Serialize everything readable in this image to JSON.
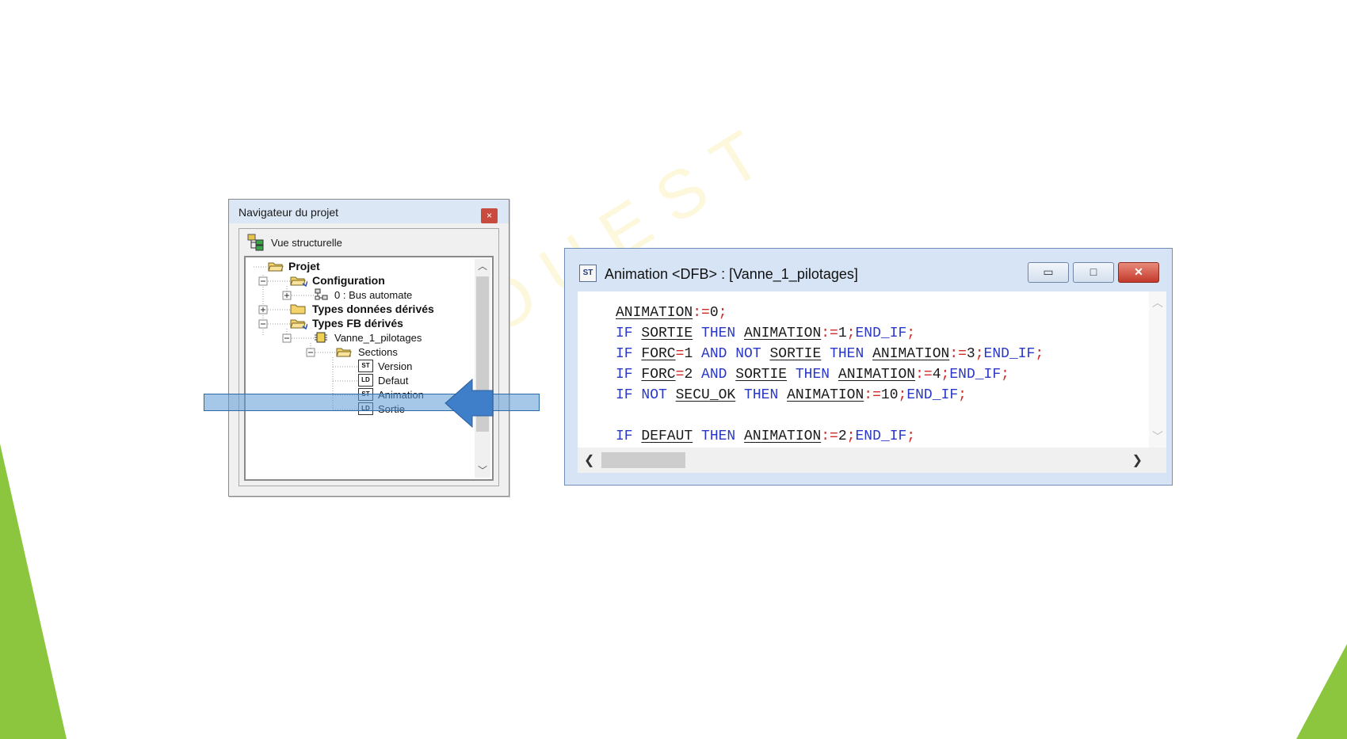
{
  "watermark": {
    "text": "AEI OUEST"
  },
  "navigator": {
    "title": "Navigateur du projet",
    "close_label": "×",
    "view_label": "Vue structurelle",
    "tree": [
      {
        "label": "Projet",
        "icon": "folder-open-icon",
        "bold": true
      },
      {
        "label": "Configuration",
        "icon": "folder-open-icon",
        "bold": true
      },
      {
        "label": "0 : Bus automate",
        "icon": "network-icon",
        "bold": false
      },
      {
        "label": "Types données dérivés",
        "icon": "folder-icon",
        "bold": true
      },
      {
        "label": "Types FB dérivés",
        "icon": "folder-open-icon",
        "bold": true
      },
      {
        "label": "Vanne_1_pilotages",
        "icon": "function-block-icon",
        "bold": false
      },
      {
        "label": "Sections",
        "icon": "folder-open-icon",
        "bold": false
      },
      {
        "label": "Version",
        "icon": "st-section-icon",
        "badge": "ST",
        "bold": false
      },
      {
        "label": "Defaut",
        "icon": "ld-section-icon",
        "badge": "LD",
        "bold": false
      },
      {
        "label": "Animation",
        "icon": "st-section-icon",
        "badge": "ST",
        "bold": false,
        "highlighted": true
      },
      {
        "label": "Sortie",
        "icon": "ld-section-icon",
        "badge": "LD",
        "bold": false
      }
    ]
  },
  "code_window": {
    "title": "Animation <DFB> : [Vanne_1_pilotages]",
    "app_icon_text": "ST",
    "buttons": {
      "minimize": "▭",
      "maximize": "□",
      "close": "✕"
    },
    "lines": [
      [
        {
          "t": "ANIMATION",
          "k": "var"
        },
        {
          "t": ":=",
          "k": "op"
        },
        {
          "t": "0",
          "k": "num"
        },
        {
          "t": ";",
          "k": "op"
        }
      ],
      [
        {
          "t": "IF ",
          "k": "kw"
        },
        {
          "t": "SORTIE",
          "k": "var"
        },
        {
          "t": " THEN ",
          "k": "kw"
        },
        {
          "t": "ANIMATION",
          "k": "var"
        },
        {
          "t": ":=",
          "k": "op"
        },
        {
          "t": "1",
          "k": "num"
        },
        {
          "t": ";",
          "k": "op"
        },
        {
          "t": "END_IF",
          "k": "kw"
        },
        {
          "t": ";",
          "k": "op"
        }
      ],
      [
        {
          "t": "IF ",
          "k": "kw"
        },
        {
          "t": "FORC",
          "k": "var"
        },
        {
          "t": "=",
          "k": "op"
        },
        {
          "t": "1",
          "k": "num"
        },
        {
          "t": " AND NOT ",
          "k": "kw"
        },
        {
          "t": "SORTIE",
          "k": "var"
        },
        {
          "t": " THEN ",
          "k": "kw"
        },
        {
          "t": "ANIMATION",
          "k": "var"
        },
        {
          "t": ":=",
          "k": "op"
        },
        {
          "t": "3",
          "k": "num"
        },
        {
          "t": ";",
          "k": "op"
        },
        {
          "t": "END_IF",
          "k": "kw"
        },
        {
          "t": ";",
          "k": "op"
        }
      ],
      [
        {
          "t": "IF ",
          "k": "kw"
        },
        {
          "t": "FORC",
          "k": "var"
        },
        {
          "t": "=",
          "k": "op"
        },
        {
          "t": "2",
          "k": "num"
        },
        {
          "t": " AND ",
          "k": "kw"
        },
        {
          "t": "SORTIE",
          "k": "var"
        },
        {
          "t": " THEN ",
          "k": "kw"
        },
        {
          "t": "ANIMATION",
          "k": "var"
        },
        {
          "t": ":=",
          "k": "op"
        },
        {
          "t": "4",
          "k": "num"
        },
        {
          "t": ";",
          "k": "op"
        },
        {
          "t": "END_IF",
          "k": "kw"
        },
        {
          "t": ";",
          "k": "op"
        }
      ],
      [
        {
          "t": "IF NOT ",
          "k": "kw"
        },
        {
          "t": "SECU_OK",
          "k": "var"
        },
        {
          "t": " THEN ",
          "k": "kw"
        },
        {
          "t": "ANIMATION",
          "k": "var"
        },
        {
          "t": ":=",
          "k": "op"
        },
        {
          "t": "10",
          "k": "num"
        },
        {
          "t": ";",
          "k": "op"
        },
        {
          "t": "END_IF",
          "k": "kw"
        },
        {
          "t": ";",
          "k": "op"
        }
      ],
      [],
      [
        {
          "t": "IF ",
          "k": "kw"
        },
        {
          "t": "DEFAUT",
          "k": "var"
        },
        {
          "t": " THEN ",
          "k": "kw"
        },
        {
          "t": "ANIMATION",
          "k": "var"
        },
        {
          "t": ":=",
          "k": "op"
        },
        {
          "t": "2",
          "k": "num"
        },
        {
          "t": ";",
          "k": "op"
        },
        {
          "t": "END_IF",
          "k": "kw"
        },
        {
          "t": ";",
          "k": "op"
        }
      ]
    ]
  },
  "colors": {
    "accent_green": "#8cc63f",
    "keyword_blue": "#2a38c8",
    "operator_red": "#d02a2a",
    "highlight_blue": "#5b9bd5",
    "arrow_blue": "#3f7ec9"
  }
}
